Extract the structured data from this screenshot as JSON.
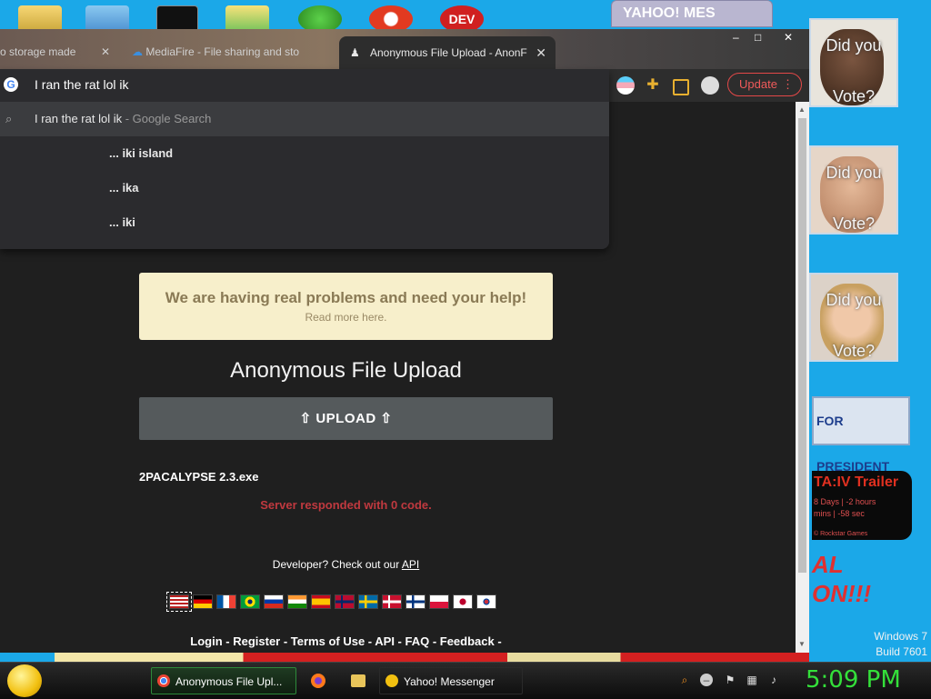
{
  "desktop": {
    "yahoo_window_title": "YAHOO! MES",
    "posters": [
      {
        "line1": "Did you",
        "line2": "Vote?"
      },
      {
        "line1": "Did you",
        "line2": "Vote?"
      },
      {
        "line1": "Did you",
        "line2": "Vote?"
      }
    ],
    "president_banner": "FOR PRESIDENT",
    "gta": {
      "title": "TA:IV Trailer",
      "line1": "8 Days | -2 hours",
      "line2": "mins | -58 sec",
      "credit": "© Rockstar Games"
    },
    "red_text": "AL\nON!!!",
    "windows_line1": "Windows 7",
    "windows_line2": "Build 7601"
  },
  "browser": {
    "tabs": [
      {
        "label": "o storage made"
      },
      {
        "label": "MediaFire - File sharing and sto"
      },
      {
        "label": "Anonymous File Upload - AnonF"
      }
    ],
    "update_label": "Update",
    "omnibox": {
      "value": "I ran the rat lol ik",
      "suggestions": [
        {
          "main": "I ran the rat lol ik",
          "suffix": " - Google Search"
        },
        {
          "main": "... iki island"
        },
        {
          "main": "... ika"
        },
        {
          "main": "... iki"
        }
      ]
    }
  },
  "page": {
    "help_title": "We are having real problems and need your help!",
    "help_sub": "Read more here.",
    "upload_title": "Anonymous File Upload",
    "upload_button": "UPLOAD",
    "filename": "2PACALYPSE 2.3.exe",
    "error": "Server responded with 0 code.",
    "dev_text": "Developer? Check out our ",
    "api_link": "API",
    "flags": [
      "us",
      "de",
      "fr",
      "br",
      "ru",
      "in",
      "es",
      "no",
      "se",
      "dk",
      "fi",
      "pl",
      "jp",
      "kr"
    ],
    "footer": "Login - Register - Terms of Use - API - FAQ - Feedback -"
  },
  "taskbar": {
    "items": [
      {
        "label": "Anonymous File Upl..."
      },
      {
        "label": "Yahoo! Messenger"
      }
    ],
    "clock": "5:09 PM"
  },
  "colors": {
    "accent_red": "#e34848",
    "clock_green": "#34e03a",
    "error_red": "#c0393f"
  }
}
